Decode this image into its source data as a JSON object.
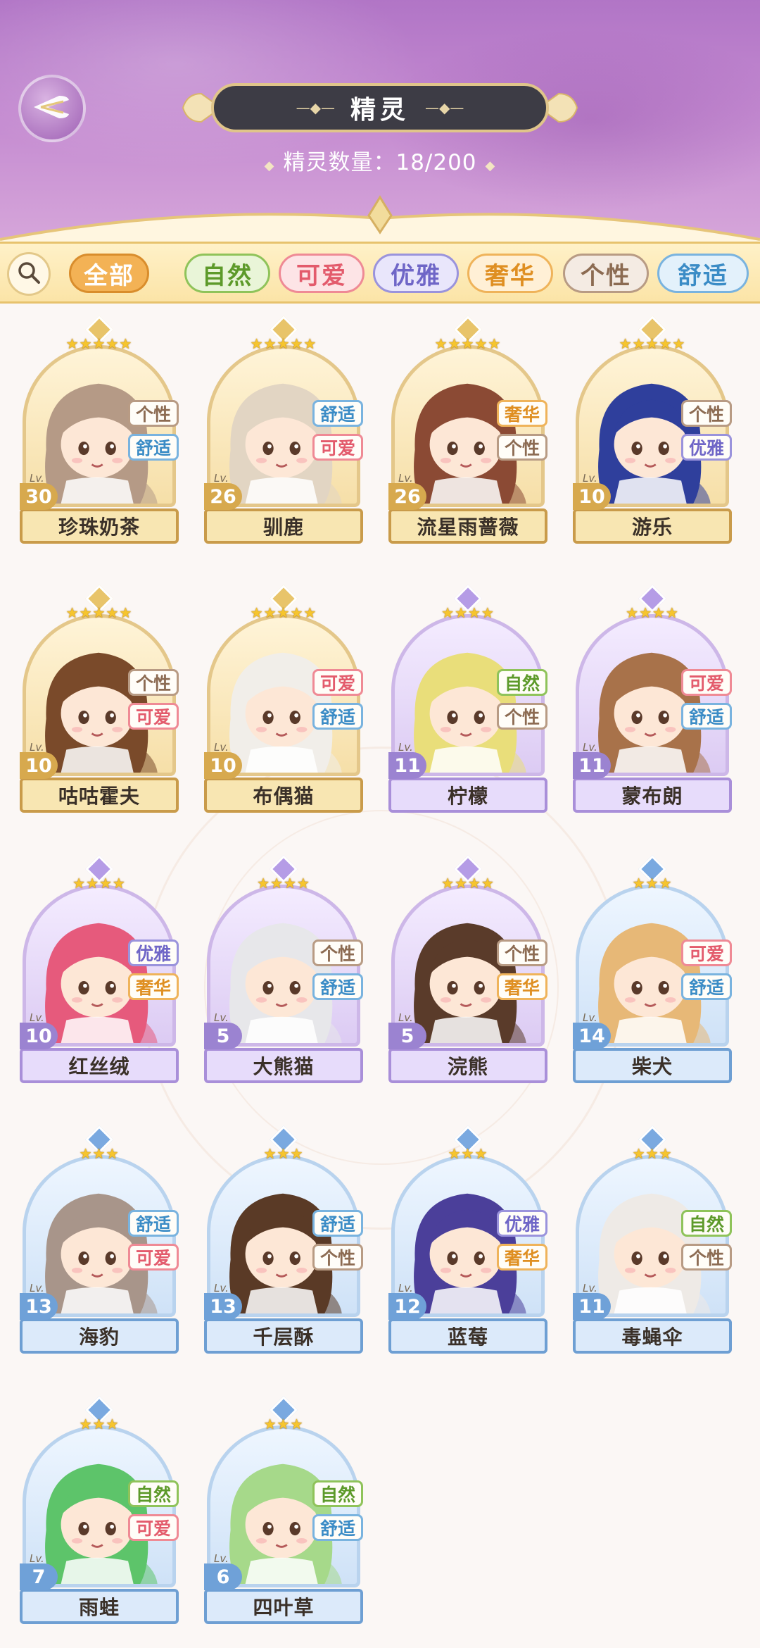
{
  "header": {
    "title": "精灵",
    "count_label": "精灵数量：",
    "count_value": "18/200"
  },
  "filters": [
    {
      "label": "全部",
      "bg": "#f3b255",
      "border": "#d98d2c",
      "text": "#ffffff"
    },
    {
      "label": "自然",
      "bg": "#e9f5d8",
      "border": "#8fc35a",
      "text": "#5d9a2a"
    },
    {
      "label": "可爱",
      "bg": "#fde4e6",
      "border": "#ef8a95",
      "text": "#e35b6c"
    },
    {
      "label": "优雅",
      "bg": "#e9e6fb",
      "border": "#9a93dc",
      "text": "#6f66c7"
    },
    {
      "label": "奢华",
      "bg": "#fff0d6",
      "border": "#efb35a",
      "text": "#df8f22"
    },
    {
      "label": "个性",
      "bg": "#f4ebe3",
      "border": "#b89b84",
      "text": "#8c6b52"
    },
    {
      "label": "舒适",
      "bg": "#e3f1fb",
      "border": "#79b3df",
      "text": "#3b8cc6"
    }
  ],
  "tag_colors": {
    "自然": {
      "border": "#8fc35a",
      "text": "#5d9a2a"
    },
    "可爱": {
      "border": "#ef8a95",
      "text": "#e35b6c"
    },
    "优雅": {
      "border": "#9a93dc",
      "text": "#6f66c7"
    },
    "奢华": {
      "border": "#efb35a",
      "text": "#df8f22"
    },
    "个性": {
      "border": "#b89b84",
      "text": "#8c6b52"
    },
    "舒适": {
      "border": "#79b3df",
      "text": "#3b8cc6"
    }
  },
  "lv_label": "Lv.",
  "sprites": [
    {
      "name": "珍珠奶茶",
      "stars": 5,
      "level": 30,
      "tags": [
        "个性",
        "舒适"
      ],
      "rarity": "gold",
      "hair": "#b59a86",
      "icon": "sprite-portrait-icon"
    },
    {
      "name": "驯鹿",
      "stars": 5,
      "level": 26,
      "tags": [
        "舒适",
        "可爱"
      ],
      "rarity": "gold",
      "hair": "#e2d5c3",
      "icon": "sprite-portrait-icon"
    },
    {
      "name": "流星雨蔷薇",
      "stars": 5,
      "level": 26,
      "tags": [
        "奢华",
        "个性"
      ],
      "rarity": "gold",
      "hair": "#8b4a34",
      "icon": "sprite-portrait-icon"
    },
    {
      "name": "游乐",
      "stars": 5,
      "level": 10,
      "tags": [
        "个性",
        "优雅"
      ],
      "rarity": "gold",
      "hair": "#2f3f9c",
      "icon": "sprite-portrait-icon"
    },
    {
      "name": "咕咕霍夫",
      "stars": 5,
      "level": 10,
      "tags": [
        "个性",
        "可爱"
      ],
      "rarity": "gold",
      "hair": "#7a4a2a",
      "icon": "sprite-portrait-icon"
    },
    {
      "name": "布偶猫",
      "stars": 5,
      "level": 10,
      "tags": [
        "可爱",
        "舒适"
      ],
      "rarity": "gold",
      "hair": "#f1eee9",
      "icon": "sprite-portrait-icon"
    },
    {
      "name": "柠檬",
      "stars": 4,
      "level": 11,
      "tags": [
        "自然",
        "个性"
      ],
      "rarity": "purple",
      "hair": "#e9de7a",
      "icon": "sprite-portrait-icon"
    },
    {
      "name": "蒙布朗",
      "stars": 4,
      "level": 11,
      "tags": [
        "可爱",
        "舒适"
      ],
      "rarity": "purple",
      "hair": "#a8724a",
      "icon": "sprite-portrait-icon"
    },
    {
      "name": "红丝绒",
      "stars": 4,
      "level": 10,
      "tags": [
        "优雅",
        "奢华"
      ],
      "rarity": "purple",
      "hair": "#e65a7c",
      "icon": "sprite-portrait-icon"
    },
    {
      "name": "大熊猫",
      "stars": 4,
      "level": 5,
      "tags": [
        "个性",
        "舒适"
      ],
      "rarity": "purple",
      "hair": "#e7e7ea",
      "icon": "sprite-portrait-icon"
    },
    {
      "name": "浣熊",
      "stars": 4,
      "level": 5,
      "tags": [
        "个性",
        "奢华"
      ],
      "rarity": "purple",
      "hair": "#5a3b2a",
      "icon": "sprite-portrait-icon"
    },
    {
      "name": "柴犬",
      "stars": 3,
      "level": 14,
      "tags": [
        "可爱",
        "舒适"
      ],
      "rarity": "blue",
      "hair": "#e7b877",
      "icon": "sprite-portrait-icon"
    },
    {
      "name": "海豹",
      "stars": 3,
      "level": 13,
      "tags": [
        "舒适",
        "可爱"
      ],
      "rarity": "blue",
      "hair": "#a8958a",
      "icon": "sprite-portrait-icon"
    },
    {
      "name": "千层酥",
      "stars": 3,
      "level": 13,
      "tags": [
        "舒适",
        "个性"
      ],
      "rarity": "blue",
      "hair": "#5a3a26",
      "icon": "sprite-portrait-icon"
    },
    {
      "name": "蓝莓",
      "stars": 3,
      "level": 12,
      "tags": [
        "优雅",
        "奢华"
      ],
      "rarity": "blue",
      "hair": "#4b3f9a",
      "icon": "sprite-portrait-icon"
    },
    {
      "name": "毒蝇伞",
      "stars": 3,
      "level": 11,
      "tags": [
        "自然",
        "个性"
      ],
      "rarity": "blue",
      "hair": "#eeeae6",
      "icon": "sprite-portrait-icon"
    },
    {
      "name": "雨蛙",
      "stars": 3,
      "level": 7,
      "tags": [
        "自然",
        "可爱"
      ],
      "rarity": "blue",
      "hair": "#5dc46a",
      "icon": "sprite-portrait-icon"
    },
    {
      "name": "四叶草",
      "stars": 3,
      "level": 6,
      "tags": [
        "自然",
        "舒适"
      ],
      "rarity": "blue",
      "hair": "#a6d98a",
      "icon": "sprite-portrait-icon"
    }
  ],
  "rarity_styles": {
    "gold": {
      "frame": "#e4c78a",
      "bg1": "#fff4d8",
      "bg2": "#f6dfa8",
      "badge": "#d7a94e",
      "plate_bg": "#f8e6b2",
      "plate_border": "#c99b4a",
      "finial": "#e8c46a"
    },
    "purple": {
      "frame": "#cdb7e8",
      "bg1": "#f4ecff",
      "bg2": "#dccbf3",
      "badge": "#9b83d1",
      "plate_bg": "#e7dcfb",
      "plate_border": "#a98fd9",
      "finial": "#b59ce6"
    },
    "blue": {
      "frame": "#b9d3ee",
      "bg1": "#eef6ff",
      "bg2": "#cfe2f7",
      "badge": "#6fa1d8",
      "plate_bg": "#dceafa",
      "plate_border": "#6e9fd3",
      "finial": "#7aa9e0"
    }
  }
}
